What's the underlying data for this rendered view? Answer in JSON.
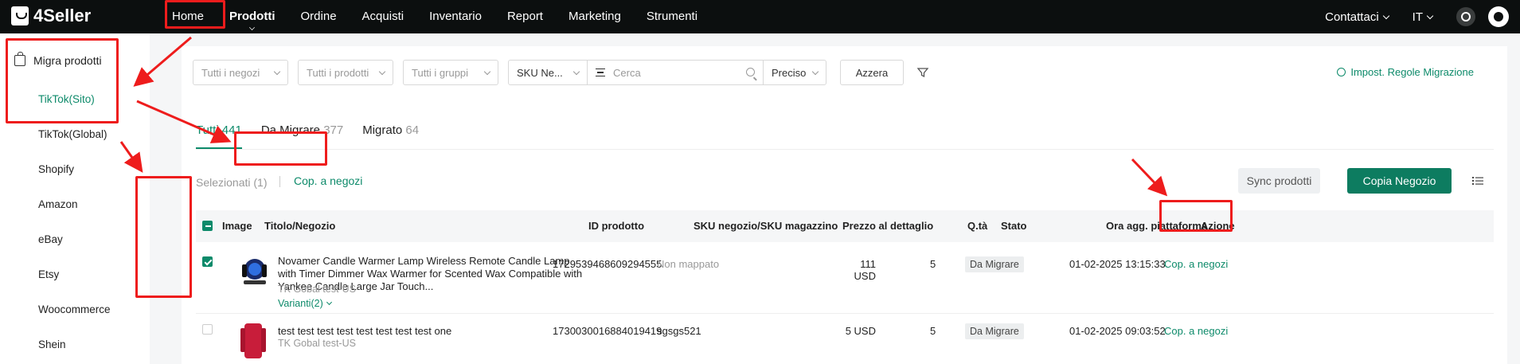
{
  "app": {
    "logo_text": "4Seller"
  },
  "nav": {
    "items": [
      "Home",
      "Prodotti",
      "Ordine",
      "Acquisti",
      "Inventario",
      "Report",
      "Marketing",
      "Strumenti"
    ],
    "active": "Prodotti"
  },
  "top_right": {
    "contact": "Contattaci",
    "language": "IT"
  },
  "sidebar": {
    "header": "Migra prodotti",
    "items": [
      "TikTok(Sito)",
      "TikTok(Global)",
      "Shopify",
      "Amazon",
      "eBay",
      "Etsy",
      "Woocommerce",
      "Shein"
    ],
    "active": "TikTok(Sito)"
  },
  "filters": {
    "stores": "Tutti i negozi",
    "products": "Tutti i prodotti",
    "groups": "Tutti i gruppi",
    "sku_type": "SKU Ne...",
    "search_placeholder": "Cerca",
    "match": "Preciso",
    "reset": "Azzera",
    "rules_link": "Impost. Regole Migrazione"
  },
  "tabs": [
    {
      "label": "Tutti",
      "count": "441"
    },
    {
      "label": "Da Migrare",
      "count": "377"
    },
    {
      "label": "Migrato",
      "count": "64"
    }
  ],
  "toolbar": {
    "selected": "Selezionati (1)",
    "copy_link": "Cop. a negozi",
    "sync": "Sync prodotti",
    "copy_store": "Copia Negozio"
  },
  "table": {
    "headers": [
      "Image",
      "Titolo/Negozio",
      "ID prodotto",
      "SKU negozio/SKU magazzino",
      "Prezzo al dettaglio",
      "Q.tà",
      "Stato",
      "Ora agg. piattaforma",
      "Azione"
    ],
    "rows": [
      {
        "checked": true,
        "title": "Novamer Candle Warmer Lamp Wireless Remote Candle Lamp with Timer Dimmer Wax Warmer for Scented Wax Compatible with Yankee Candle Large Jar Touch...",
        "store": "TK Gobal test-US",
        "variants": "Varianti(2)",
        "product_id": "1729539468609294555",
        "sku": "Non mappato",
        "price": "111 USD",
        "qty": "5",
        "status": "Da Migrare",
        "updated": "01-02-2025 13:15:33",
        "action": "Cop. a negozi"
      },
      {
        "checked": false,
        "title": "test test test test test test test test one",
        "store": "TK Gobal test-US",
        "product_id": "1730030016884019419",
        "sku": "sgsgs521",
        "price": "5 USD",
        "qty": "5",
        "status": "Da Migrare",
        "updated": "01-02-2025 09:03:52",
        "action": "Cop. a negozi"
      }
    ]
  },
  "colors": {
    "brand_green": "#0d8a6a",
    "button_green": "#0d7c60",
    "annotation_red": "#ee1c1c",
    "topbar": "#0c0f0f"
  }
}
